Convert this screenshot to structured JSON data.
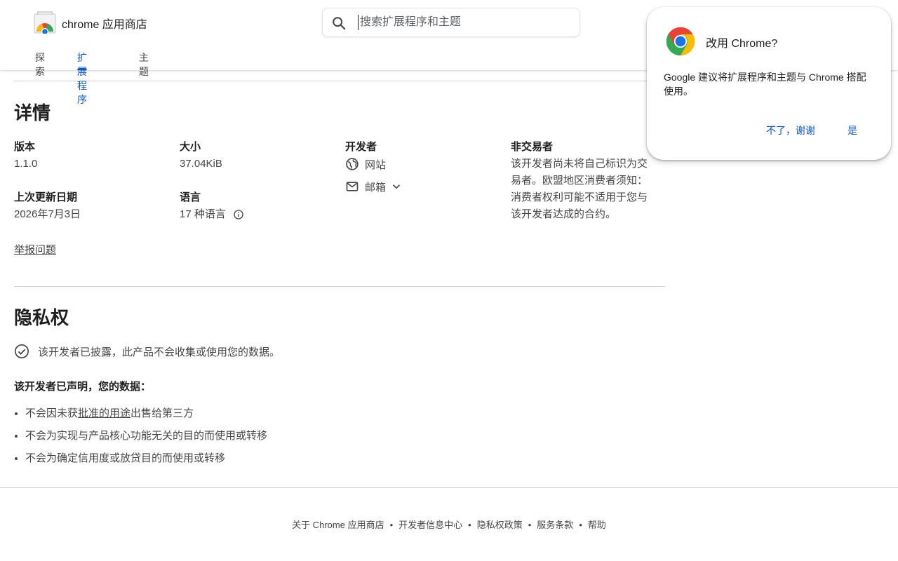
{
  "header": {
    "store_name": "chrome 应用商店",
    "search_placeholder": "搜索扩展程序和主题",
    "tabs": [
      {
        "label": "探索"
      },
      {
        "label": "扩展程序"
      },
      {
        "label": "主题"
      }
    ],
    "active_tab": "扩展程序"
  },
  "details": {
    "title": "详情",
    "version_label": "版本",
    "version_value": "1.1.0",
    "size_label": "大小",
    "size_value": "37.04KiB",
    "developer_label": "开发者",
    "website_label": "网站",
    "email_label": "邮箱",
    "non_trader_label": "非交易者",
    "non_trader_text": "该开发者尚未将自己标识为交易者。欧盟地区消费者须知：消费者权利可能不适用于您与该开发者达成的合约。",
    "updated_label": "上次更新日期",
    "updated_value": "2026年7月3日",
    "language_label": "语言",
    "language_value": "17 种语言",
    "report_link": "举报问题"
  },
  "privacy": {
    "title": "隐私权",
    "disclosure": "该开发者已披露，此产品不会收集或使用您的数据。",
    "declared_heading": "该开发者已声明，您的数据：",
    "bullet1_prefix": "不会因未获",
    "bullet1_link": "批准的用途",
    "bullet1_suffix": "出售给第三方",
    "bullet2": "不会为实现与产品核心功能无关的目的而使用或转移",
    "bullet3": "不会为确定信用度或放贷目的而使用或转移"
  },
  "footer": {
    "links": [
      "关于 Chrome 应用商店",
      "开发者信息中心",
      "隐私权政策",
      "服务条款",
      "帮助"
    ],
    "separator": "•"
  },
  "popup": {
    "title": "改用 Chrome?",
    "body": "Google 建议将扩展程序和主题与 Chrome 搭配使用。",
    "decline_label": "不了，谢谢",
    "accept_label": "是"
  },
  "colors": {
    "accent": "#0b57d0",
    "text": "#1f1f1f",
    "secondary_text": "#444746",
    "divider": "#d0d0d0"
  },
  "icons": [
    "chrome-web-store-logo-icon",
    "search-icon",
    "globe-icon",
    "mail-icon",
    "chevron-down-icon",
    "info-icon",
    "check-circle-icon",
    "chrome-logo-icon"
  ]
}
